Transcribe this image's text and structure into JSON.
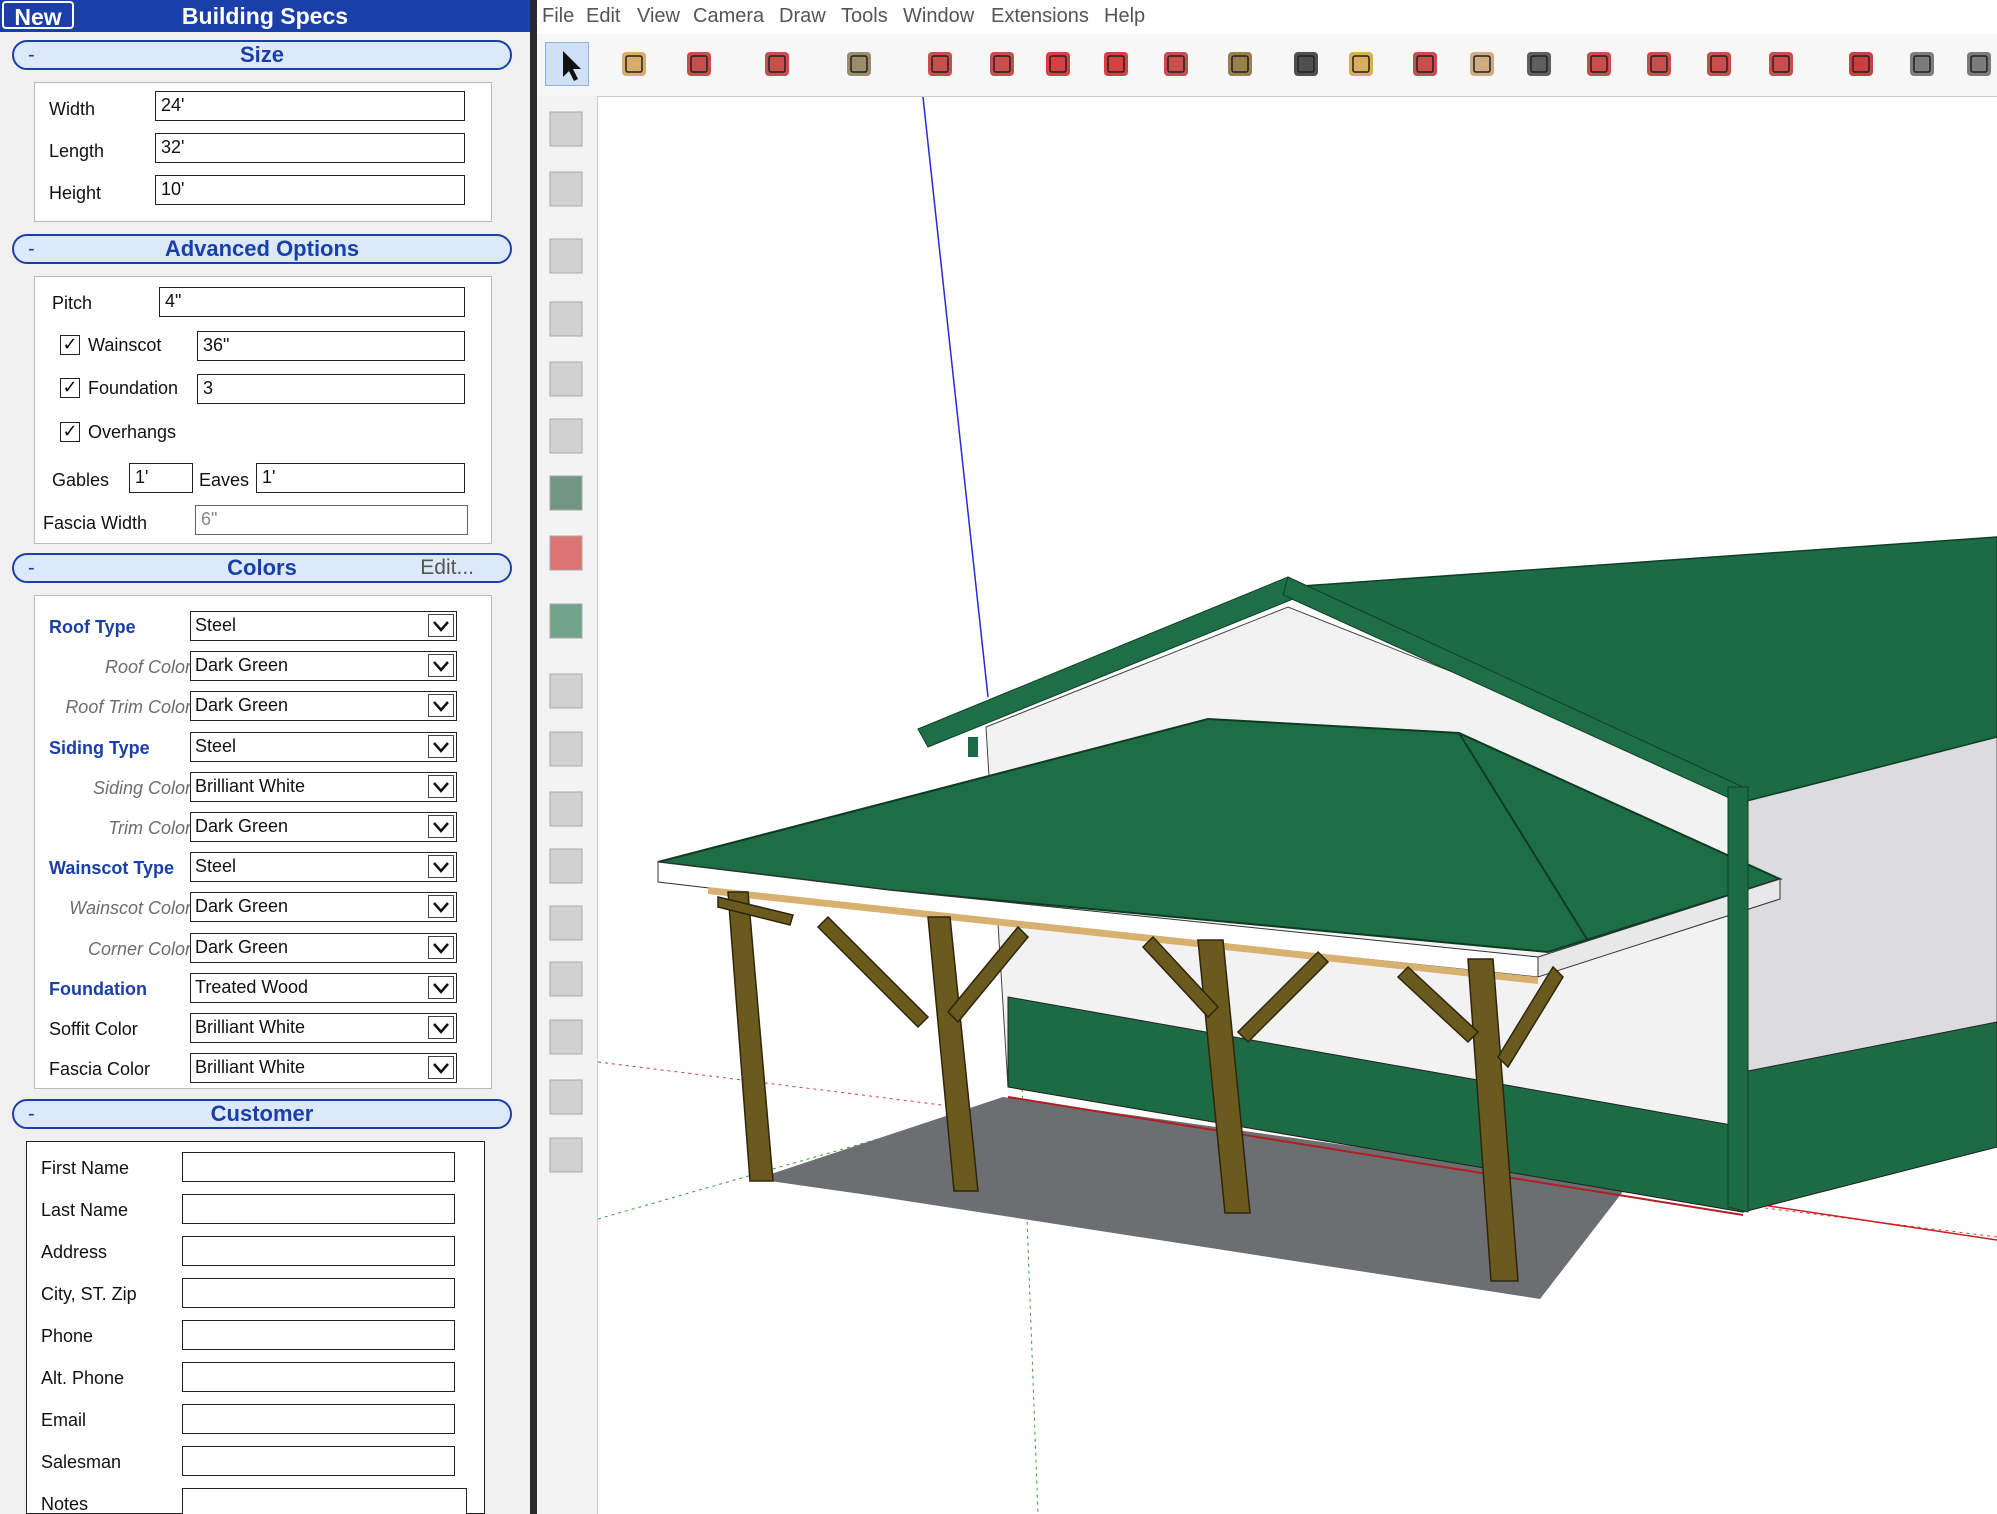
{
  "panel": {
    "new_label": "New",
    "title": "Building Specs",
    "collapse_symbol": "-"
  },
  "size": {
    "title": "Size",
    "width_label": "Width",
    "width_value": "24'",
    "length_label": "Length",
    "length_value": "32'",
    "height_label": "Height",
    "height_value": "10'"
  },
  "advanced": {
    "title": "Advanced Options",
    "pitch_label": "Pitch",
    "pitch_value": "4\"",
    "wainscot_label": "Wainscot",
    "wainscot_value": "36\"",
    "wainscot_checked": true,
    "foundation_label": "Foundation",
    "foundation_value": "3",
    "foundation_checked": true,
    "overhangs_label": "Overhangs",
    "overhangs_checked": true,
    "gables_label": "Gables",
    "gables_value": "1'",
    "eaves_label": "Eaves",
    "eaves_value": "1'",
    "fascia_label": "Fascia Width",
    "fascia_value": "6\""
  },
  "colors": {
    "title": "Colors",
    "edit_label": "Edit...",
    "rows": [
      {
        "label": "Roof Type",
        "value": "Steel",
        "style": "bold"
      },
      {
        "label": "Roof Color",
        "value": "Dark Green",
        "style": "italic"
      },
      {
        "label": "Roof Trim Color",
        "value": "Dark Green",
        "style": "italic"
      },
      {
        "label": "Siding Type",
        "value": "Steel",
        "style": "bold"
      },
      {
        "label": "Siding Color",
        "value": "Brilliant White",
        "style": "italic"
      },
      {
        "label": "Trim Color",
        "value": "Dark Green",
        "style": "italic"
      },
      {
        "label": "Wainscot Type",
        "value": "Steel",
        "style": "bold"
      },
      {
        "label": "Wainscot Color",
        "value": "Dark Green",
        "style": "italic"
      },
      {
        "label": "Corner Color",
        "value": "Dark Green",
        "style": "italic"
      },
      {
        "label": "Foundation",
        "value": "Treated Wood",
        "style": "bold"
      },
      {
        "label": "Soffit Color",
        "value": "Brilliant White",
        "style": "normal"
      },
      {
        "label": "Fascia Color",
        "value": "Brilliant White",
        "style": "normal"
      }
    ]
  },
  "customer": {
    "title": "Customer",
    "fields": [
      {
        "label": "First Name",
        "value": ""
      },
      {
        "label": "Last Name",
        "value": ""
      },
      {
        "label": "Address",
        "value": ""
      },
      {
        "label": "City, ST. Zip",
        "value": ""
      },
      {
        "label": "Phone",
        "value": ""
      },
      {
        "label": "Alt. Phone",
        "value": ""
      },
      {
        "label": "Email",
        "value": ""
      },
      {
        "label": "Salesman",
        "value": ""
      },
      {
        "label": "Notes",
        "value": ""
      }
    ]
  },
  "menubar": [
    "File",
    "Edit",
    "View",
    "Camera",
    "Draw",
    "Tools",
    "Window",
    "Extensions",
    "Help"
  ],
  "toolbar_icons": [
    "select-icon",
    "eraser-icon",
    "pencil-icon",
    "arc-icon",
    "shape-icon",
    "push-pull-icon",
    "follow-me-icon",
    "move-icon",
    "rotate-icon",
    "scale-icon",
    "tape-measure-icon",
    "text-icon",
    "paint-bucket-icon",
    "orbit-icon",
    "pan-icon",
    "zoom-icon",
    "zoom-extents-icon",
    "warehouse-icon",
    "extension-warehouse-icon",
    "layout-icon",
    "ruby-icon",
    "house-icon",
    "component-icon"
  ],
  "sidebar_icons": [
    "spec-sheet-icon",
    "lean-to-icon",
    "door-icon",
    "garage-door-icon",
    "window-icon",
    "panel-icon",
    "cupola-icon",
    "wainscot-icon",
    "excel-icon",
    "dimension-icon",
    "angle-dimension-icon",
    "truss-icon",
    "envelope-icon",
    "mail-icon",
    "roof-icon",
    "print-icon",
    "settings-icon",
    "columns-icon"
  ],
  "theme": {
    "accent": "#1a3fa8",
    "section_bg": "#dbe9fb",
    "roof_green": "#1d6b44",
    "siding_white": "#f2f2f2",
    "wood": "#6b5a1d",
    "floor": "#6c6e72"
  }
}
